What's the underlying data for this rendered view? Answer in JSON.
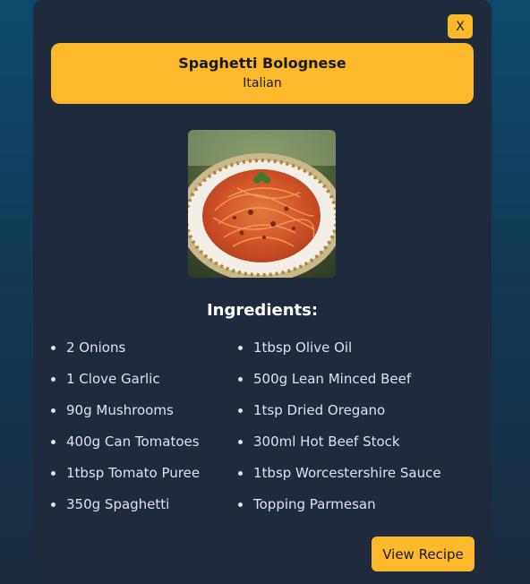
{
  "modal": {
    "close_label": "X",
    "title": "Spaghetti Bolognese",
    "cuisine": "Italian",
    "ingredients_heading": "Ingredients:",
    "ingredients_left": [
      "2 Onions",
      "1 Clove Garlic",
      "90g Mushrooms",
      "400g Can Tomatoes",
      "1tbsp Tomato Puree",
      "350g Spaghetti"
    ],
    "ingredients_right": [
      "1tbsp Olive Oil",
      "500g Lean Minced Beef",
      "1tsp Dried Oregano",
      "300ml Hot Beef Stock",
      "1tbsp Worcestershire Sauce",
      "Topping Parmesan"
    ],
    "view_recipe_label": "View Recipe"
  },
  "colors": {
    "accent": "#fdb92c",
    "modal_bg": "#1f2a3d",
    "text_light": "#dde3ea"
  }
}
